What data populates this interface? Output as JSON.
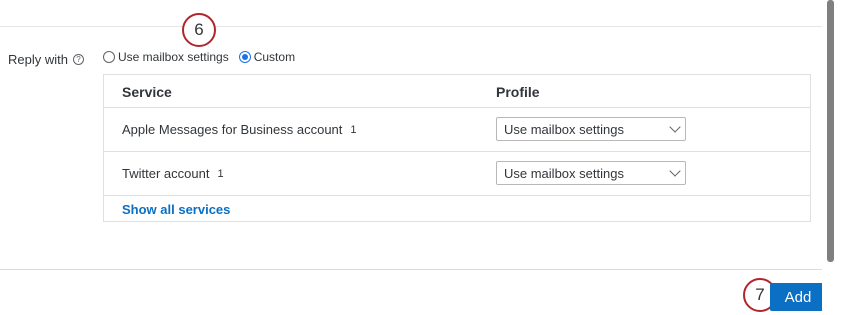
{
  "callouts": {
    "step_six": "6",
    "step_seven": "7"
  },
  "reply": {
    "label": "Reply with",
    "help_icon": "question-circle-icon",
    "options": [
      {
        "label": "Use mailbox settings",
        "checked": false
      },
      {
        "label": "Custom",
        "checked": true
      }
    ]
  },
  "table": {
    "headers": {
      "service": "Service",
      "profile": "Profile"
    },
    "rows": [
      {
        "service": "Apple Messages for Business account",
        "count": "1",
        "profile": "Use mailbox settings"
      },
      {
        "service": "Twitter account",
        "count": "1",
        "profile": "Use mailbox settings"
      }
    ],
    "show_all": "Show all services"
  },
  "footer": {
    "add_label": "Add"
  },
  "colors": {
    "accent": "#0b6fc4",
    "callout_border": "#b0262d",
    "radio_accent": "#1a73e8"
  }
}
